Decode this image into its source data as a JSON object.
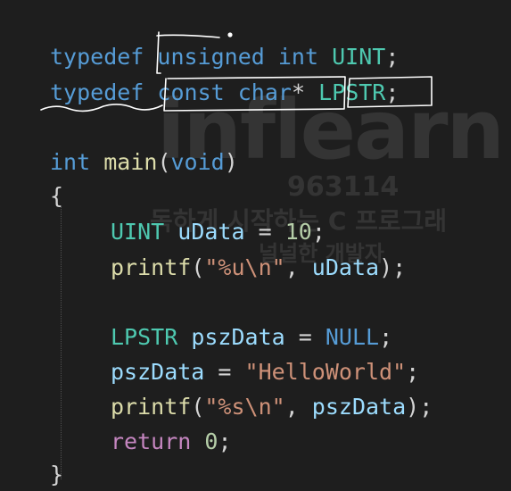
{
  "code": {
    "line1": {
      "kw": "typedef",
      "type": "unsigned int",
      "alias": "UINT",
      "end": ";"
    },
    "line2": {
      "kw": "typedef",
      "type1": "const",
      "type2": "char",
      "star": "*",
      "alias": "LPSTR",
      "end": ";"
    },
    "line4": {
      "type": "int",
      "fn": "main",
      "open": "(",
      "param": "void",
      "close": ")"
    },
    "line5": {
      "brace": "{"
    },
    "line6": {
      "type": "UINT",
      "var": "uData",
      "op": " = ",
      "num": "10",
      "end": ";"
    },
    "line7": {
      "fn": "printf",
      "open": "(",
      "str": "\"%u\\n\"",
      "sep": ", ",
      "var": "uData",
      "end": ");"
    },
    "line9": {
      "type": "LPSTR",
      "var": "pszData",
      "op": " = ",
      "val": "NULL",
      "end": ";"
    },
    "line10": {
      "var": "pszData",
      "op": " = ",
      "str": "\"HelloWorld\"",
      "end": ";"
    },
    "line11": {
      "fn": "printf",
      "open": "(",
      "str": "\"%s\\n\"",
      "sep": ", ",
      "var": "pszData",
      "end": ");"
    },
    "line12": {
      "kw": "return",
      "num": "0",
      "end": ";"
    },
    "line13": {
      "brace": "}"
    }
  },
  "watermark": {
    "logo": "inflearn",
    "id": "963114",
    "title": "독하게 시작하는 C 프로그래",
    "sub": "널널한 개발자"
  },
  "colors": {
    "background": "#1e1e1e",
    "keyword": "#569cd6",
    "control": "#c586c0",
    "type": "#4ec9b0",
    "function": "#dcdcaa",
    "variable": "#9cdcfe",
    "number": "#b5cea8",
    "string": "#ce9178",
    "annotation": "#ffffff"
  }
}
